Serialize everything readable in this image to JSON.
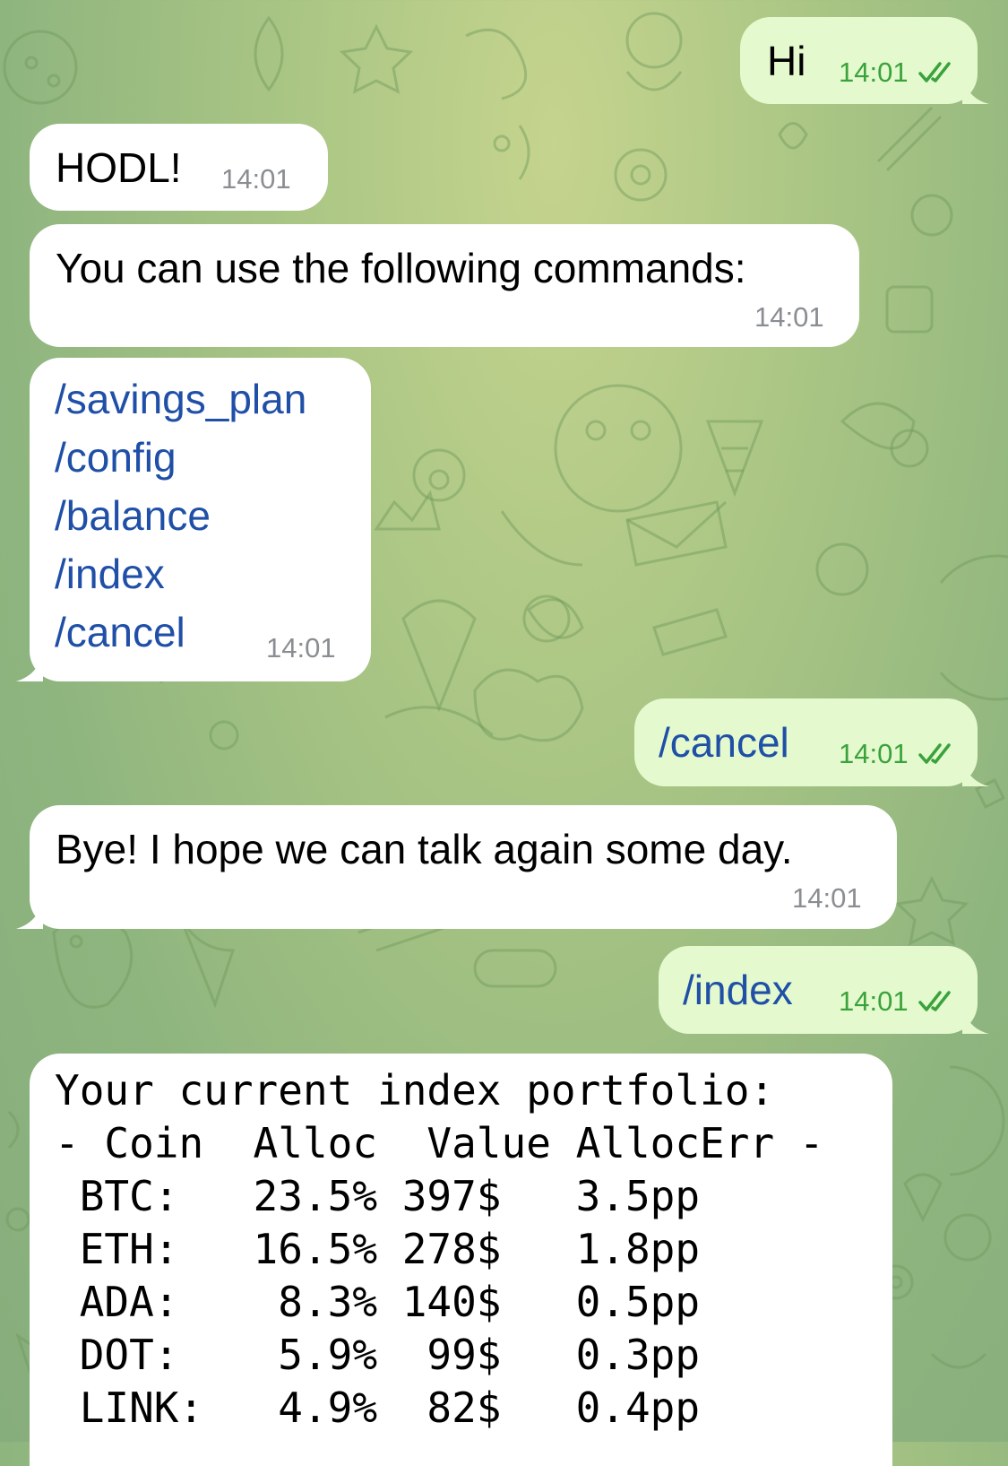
{
  "messages": [
    {
      "side": "out",
      "text": "Hi",
      "time": "14:01"
    },
    {
      "side": "in",
      "text": "HODL!",
      "time": "14:01"
    },
    {
      "side": "in",
      "text": "You can use the following commands:",
      "time": "14:01"
    },
    {
      "side": "in",
      "commands": [
        "/savings_plan",
        "/config",
        "/balance",
        "/index",
        "/cancel"
      ],
      "time": "14:01"
    },
    {
      "side": "out",
      "text": "/cancel",
      "time": "14:01"
    },
    {
      "side": "in",
      "text": "Bye! I hope we can talk again some day.",
      "time": "14:01"
    },
    {
      "side": "out",
      "text": "/index",
      "time": "14:01"
    }
  ],
  "portfolio": {
    "title": "Your current index portfolio:",
    "header": "- Coin  Alloc  Value AllocErr -",
    "rows": [
      " BTC:   23.5% 397$   3.5pp",
      " ETH:   16.5% 278$   1.8pp",
      " ADA:    8.3% 140$   0.5pp",
      " DOT:    5.9%  99$   0.3pp",
      " LINK:   4.9%  82$   0.4pp"
    ]
  },
  "colors": {
    "incoming_bubble": "#ffffff",
    "outgoing_bubble": "#e4f9cd",
    "command_link": "#1f4fa7",
    "outgoing_time": "#3aa23c",
    "incoming_time": "#8a8e92"
  },
  "icons": {
    "read_receipt": "double-check-icon"
  }
}
